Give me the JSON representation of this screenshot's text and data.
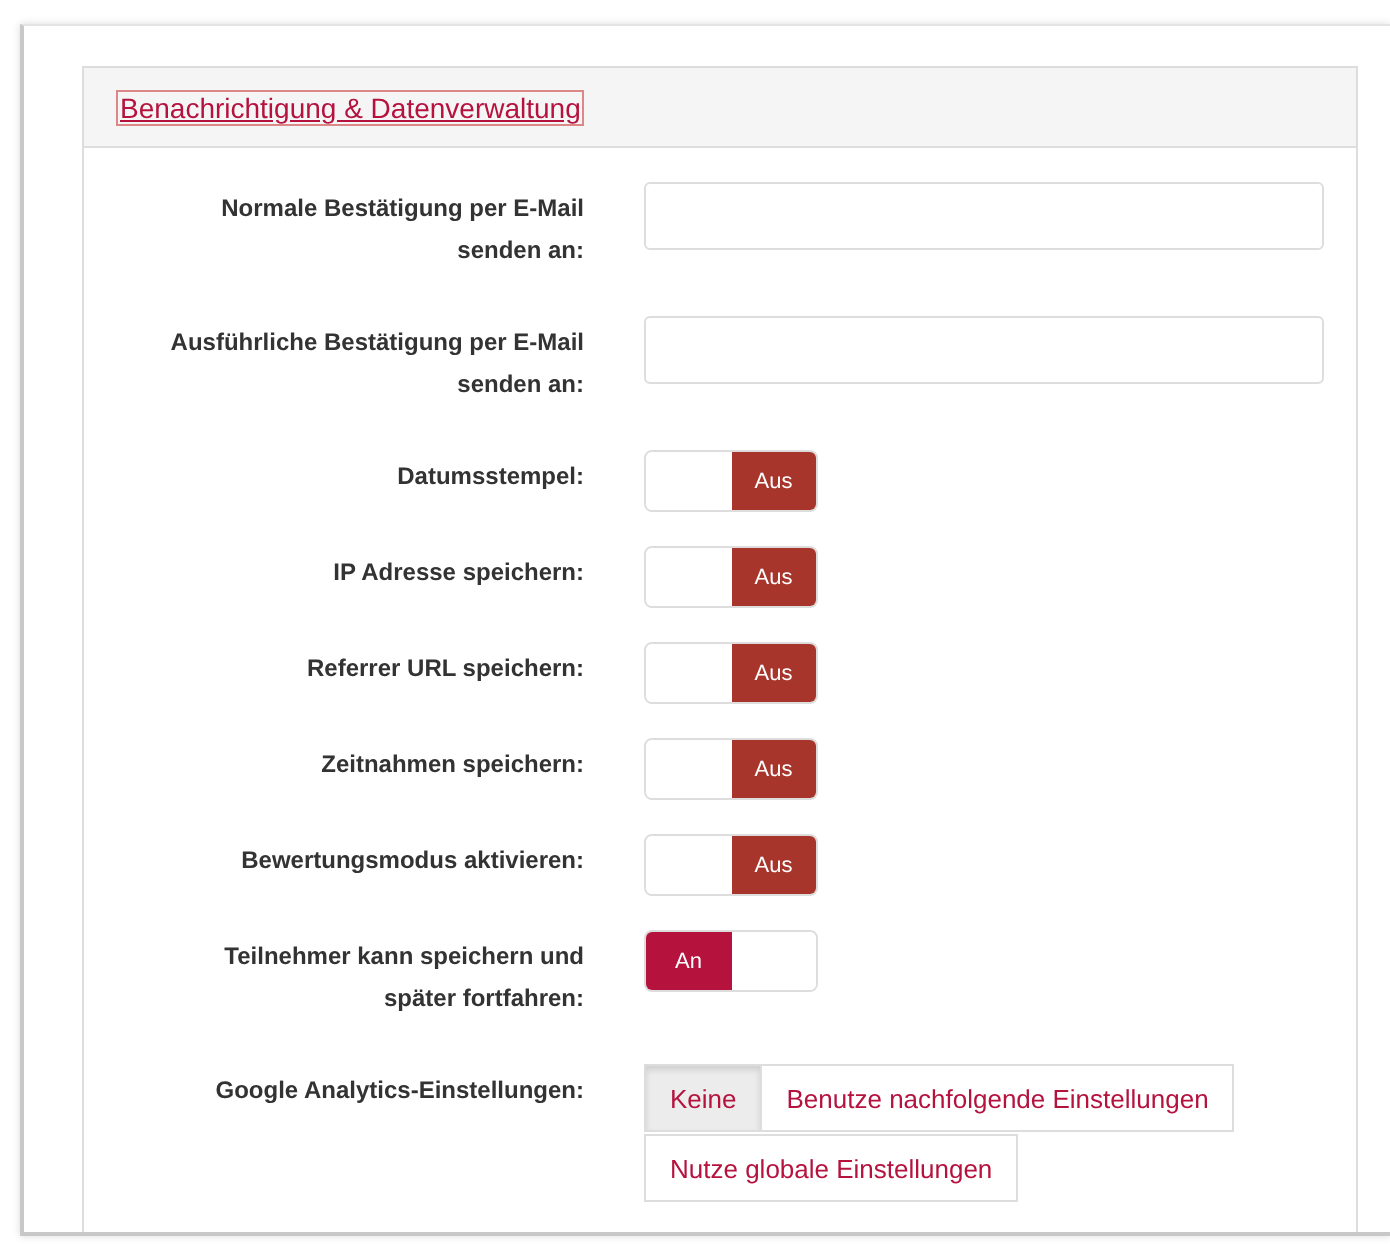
{
  "section": {
    "title": "Benachrichtigung & Datenverwaltung"
  },
  "fields": [
    {
      "kind": "text",
      "label": "Normale Bestätigung per E-Mail senden an:"
    },
    {
      "kind": "text",
      "label": "Ausführliche Bestätigung per E-Mail senden an:"
    },
    {
      "kind": "toggle",
      "label": "Datumsstempel:",
      "on": false,
      "text": "Aus"
    },
    {
      "kind": "toggle",
      "label": "IP Adresse speichern:",
      "on": false,
      "text": "Aus"
    },
    {
      "kind": "toggle",
      "label": "Referrer URL speichern:",
      "on": false,
      "text": "Aus"
    },
    {
      "kind": "toggle",
      "label": "Zeitnahmen speichern:",
      "on": false,
      "text": "Aus"
    },
    {
      "kind": "toggle",
      "label": "Bewertungsmodus aktivieren:",
      "on": false,
      "text": "Aus"
    },
    {
      "kind": "toggle",
      "label": "Teilnehmer kann speichern und später fortfahren:",
      "on": true,
      "text": "An"
    },
    {
      "kind": "choice",
      "label": "Google Analytics-Einstellungen:",
      "options": [
        {
          "label": "Keine",
          "selected": true
        },
        {
          "label": "Benutze nachfolgende Einstellungen",
          "selected": false
        },
        {
          "label": "Nutze globale Einstellungen",
          "selected": false
        }
      ]
    }
  ]
}
